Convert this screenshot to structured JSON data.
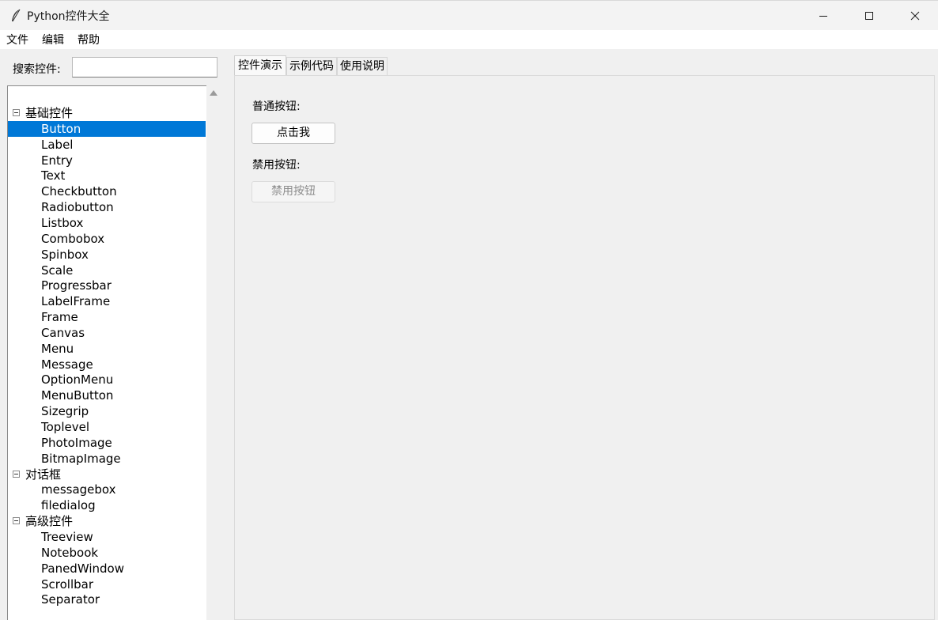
{
  "window": {
    "title": "Python控件大全",
    "icon": "feather-icon"
  },
  "menu": {
    "items": [
      "文件",
      "编辑",
      "帮助"
    ]
  },
  "search": {
    "label": "搜索控件:",
    "value": ""
  },
  "tree": {
    "selected": "Button",
    "groups": [
      {
        "label": "基础控件",
        "expanded": true,
        "items": [
          "Button",
          "Label",
          "Entry",
          "Text",
          "Checkbutton",
          "Radiobutton",
          "Listbox",
          "Combobox",
          "Spinbox",
          "Scale",
          "Progressbar",
          "LabelFrame",
          "Frame",
          "Canvas",
          "Menu",
          "Message",
          "OptionMenu",
          "MenuButton",
          "Sizegrip",
          "Toplevel",
          "PhotoImage",
          "BitmapImage"
        ]
      },
      {
        "label": "对话框",
        "expanded": true,
        "items": [
          "messagebox",
          "filedialog"
        ]
      },
      {
        "label": "高级控件",
        "expanded": true,
        "items": [
          "Treeview",
          "Notebook",
          "PanedWindow",
          "Scrollbar",
          "Separator"
        ]
      }
    ]
  },
  "tabs": {
    "items": [
      "控件演示",
      "示例代码",
      "使用说明"
    ],
    "active": 0
  },
  "demo": {
    "normal_label": "普通按钮:",
    "normal_button": "点击我",
    "disabled_label": "禁用按钮:",
    "disabled_button": "禁用按钮"
  },
  "colors": {
    "selection": "#0078d7",
    "window_bg": "#f0f0f0"
  }
}
